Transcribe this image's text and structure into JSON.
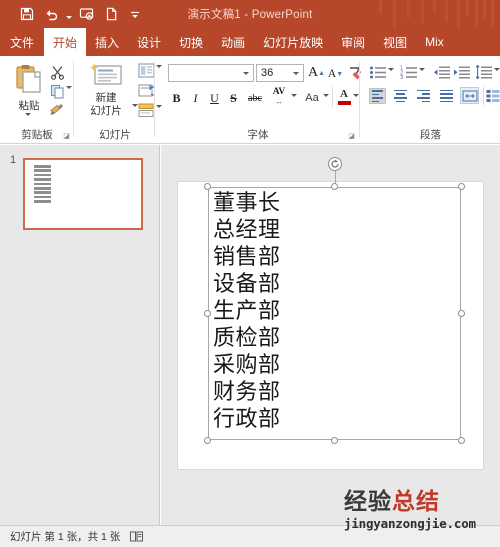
{
  "window": {
    "title": "演示文稿1 - PowerPoint",
    "accent_color": "#b7472a",
    "quick_access": [
      {
        "name": "save",
        "icon": "save-icon"
      },
      {
        "name": "undo",
        "icon": "undo-icon"
      },
      {
        "name": "start-slideshow",
        "icon": "slideshow-icon"
      },
      {
        "name": "new",
        "icon": "new-file-icon"
      },
      {
        "name": "customize",
        "icon": "customize-qat-icon"
      }
    ]
  },
  "ribbon": {
    "tabs": [
      {
        "label": "文件",
        "active": false
      },
      {
        "label": "开始",
        "active": true
      },
      {
        "label": "插入",
        "active": false
      },
      {
        "label": "设计",
        "active": false
      },
      {
        "label": "切换",
        "active": false
      },
      {
        "label": "动画",
        "active": false
      },
      {
        "label": "幻灯片放映",
        "active": false
      },
      {
        "label": "审阅",
        "active": false
      },
      {
        "label": "视图",
        "active": false
      },
      {
        "label": "Mix",
        "active": false
      }
    ],
    "groups": {
      "clipboard": {
        "label": "剪贴板",
        "paste_label": "粘贴",
        "cut_name": "cut",
        "copy_name": "copy",
        "format_painter_name": "format-painter"
      },
      "slides": {
        "label": "幻灯片",
        "new_slide_label_line1": "新建",
        "new_slide_label_line2": "幻灯片",
        "layout_name": "slide-layout",
        "reset_name": "slide-reset",
        "section_name": "slide-section"
      },
      "font": {
        "label": "字体",
        "font_name_value": "",
        "font_name_placeholder": "",
        "font_size_value": "36",
        "grow_font": "A",
        "shrink_font": "A",
        "clear_formatting_name": "clear-formatting",
        "bold": "B",
        "italic": "I",
        "underline": "U",
        "strikethrough": "S",
        "text_shadow": "abc",
        "character_spacing": "AV",
        "change_case": "Aa",
        "font_color_letter": "A",
        "font_color_swatch": "#c00000"
      },
      "paragraph": {
        "label": "段落",
        "bullets_name": "bullets",
        "numbering_name": "numbering",
        "decrease_indent_name": "decrease-indent",
        "increase_indent_name": "increase-indent",
        "line_spacing_name": "line-spacing",
        "align_left_name": "align-left",
        "align_center_name": "align-center",
        "align_right_name": "align-right",
        "align_justify_name": "align-justify",
        "columns_name": "columns",
        "text_direction_name": "text-direction",
        "selected_alignment": "align-left"
      }
    }
  },
  "slide_panel": {
    "slide_number": "1",
    "thumbnail_line_count": 9
  },
  "slide": {
    "textbox_selected": true,
    "lines": [
      "董事长",
      "总经理",
      "销售部",
      "设备部",
      "生产部",
      "质检部",
      "采购部",
      "财务部",
      "行政部"
    ]
  },
  "status_bar": {
    "slide_status": "幻灯片 第 1 张，共 1 张",
    "notes_icon": "notes-icon"
  },
  "watermark": {
    "text_dark": "经验",
    "text_red": "总结",
    "url": "jingyanzongjie.com",
    "red": "#c0392b"
  }
}
